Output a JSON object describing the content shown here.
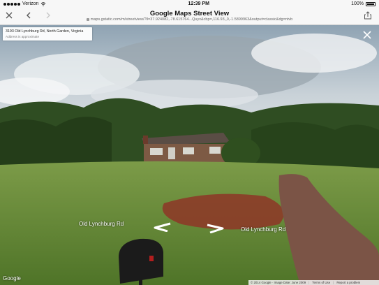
{
  "status_bar": {
    "carrier": "Verizon",
    "time": "12:39 PM",
    "battery": "100%"
  },
  "browser": {
    "title": "Google Maps Street View",
    "url": "maps.gstatic.com/m/streetview/?ll=37.924082,-78.615764...Quyx&cbp=,116.93,,0,-1.5899963&output=classic&dg=ntvb",
    "icons": {
      "close": "close-icon",
      "back": "back-icon",
      "forward": "forward-icon",
      "share": "share-icon",
      "lock": "lock-icon"
    }
  },
  "street_view": {
    "address": "3193 Old Lynchburg Rd, North Garden, Virginia",
    "address_note": "Address is approximate",
    "road_label_left": "Old Lynchburg Rd",
    "road_label_right": "Old Lynchburg Rd",
    "logo": "Google"
  },
  "footer": {
    "copyright": "© 2014 Google · Image Date: June 2009",
    "terms": "Terms of Use",
    "report": "Report a problem"
  },
  "colors": {
    "sky": "#b6c2cb",
    "grass": "#6f8f3d",
    "tree": "#2c4a1e",
    "dirt": "#8a3f2c",
    "driveway": "#7a5442"
  }
}
